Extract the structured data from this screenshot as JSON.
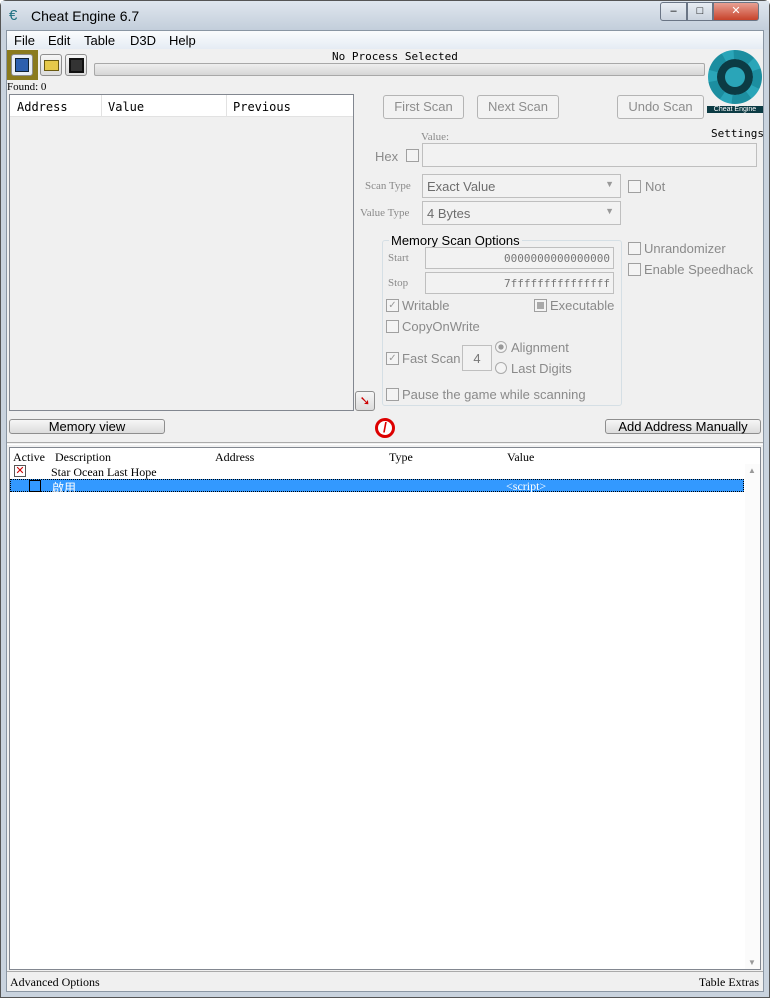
{
  "window": {
    "title": "Cheat Engine 6.7",
    "minimize": "–",
    "maximize": "□",
    "close": "✕"
  },
  "menu": [
    "File",
    "Edit",
    "Table",
    "D3D",
    "Help"
  ],
  "toolbar": {
    "icons": [
      "open-process-icon",
      "open-file-icon",
      "save-icon"
    ]
  },
  "process_label": "No Process Selected",
  "progress": 0,
  "found": "Found: 0",
  "results_columns": [
    "Address",
    "Value",
    "Previous"
  ],
  "scan": {
    "first": "First Scan",
    "next": "Next Scan",
    "undo": "Undo Scan",
    "settings": "Settings",
    "logo_text": "Cheat Engine"
  },
  "value_label": "Value:",
  "hex_label": "Hex",
  "value_input": "",
  "scan_type_label": "Scan Type",
  "scan_type": "Exact Value",
  "not_label": "Not",
  "value_type_label": "Value Type",
  "value_type": "4 Bytes",
  "mem": {
    "title": "Memory Scan Options",
    "start_label": "Start",
    "start": "0000000000000000",
    "stop_label": "Stop",
    "stop": "7fffffffffffffff",
    "writable": "Writable",
    "executable": "Executable",
    "copyonwrite": "CopyOnWrite",
    "fastscan": "Fast Scan",
    "fastscan_value": "4",
    "alignment": "Alignment",
    "lastdigits": "Last Digits",
    "pause": "Pause the game while scanning"
  },
  "unrandomizer": "Unrandomizer",
  "speedhack": "Enable Speedhack",
  "memory_view": "Memory view",
  "add_address": "Add Address Manually",
  "table_columns": [
    "Active",
    "Description",
    "Address",
    "Type",
    "Value"
  ],
  "table_rows": [
    {
      "description": "Star Ocean Last Hope",
      "address": "",
      "type": "",
      "value": "",
      "active": "x"
    },
    {
      "description": "啟用",
      "address": "",
      "type": "",
      "value": "<script>",
      "active": "off"
    }
  ],
  "advanced": "Advanced Options",
  "table_extras": "Table Extras",
  "colors": {
    "selection": "#3399ff",
    "logo": "#1c8ea0"
  }
}
